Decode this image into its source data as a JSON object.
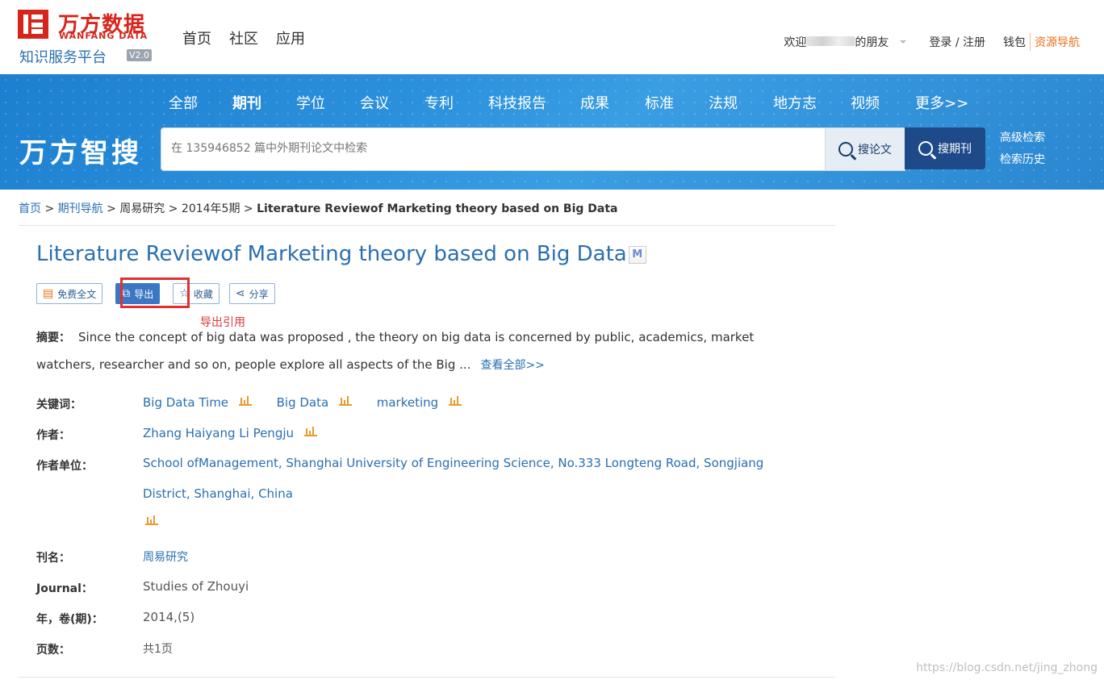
{
  "brand": {
    "logo_cn": "万方数据",
    "logo_en": "WANFANG DATA",
    "subtitle": "知识服务平台",
    "version": "V2.0",
    "search_brand": "万方智搜"
  },
  "top_nav": [
    "首页",
    "社区",
    "应用"
  ],
  "user": {
    "welcome_prefix": "欢迎",
    "welcome_suffix": "的朋友",
    "login": "登录 / 注册",
    "wallet": "钱包",
    "resources": "资源导航"
  },
  "categories": [
    "全部",
    "期刊",
    "学位",
    "会议",
    "专利",
    "科技报告",
    "成果",
    "标准",
    "法规",
    "地方志",
    "视频",
    "更多>>"
  ],
  "active_category": "期刊",
  "search": {
    "placeholder": "在 135946852 篇中外期刊论文中检索",
    "btn_paper": "搜论文",
    "btn_journal": "搜期刊",
    "advanced": "高级检索",
    "history": "检索历史"
  },
  "breadcrumb": {
    "home": "首页",
    "nav": "期刊导航",
    "journal": "周易研究",
    "issue": "2014年5期",
    "current": "Literature Reviewof Marketing theory based on Big Data",
    "sep": ">"
  },
  "article": {
    "title": "Literature Reviewof Marketing theory based on Big Data",
    "m_badge": "M",
    "actions": {
      "fulltext": "免费全文",
      "export": "导出",
      "favorite": "收藏",
      "share": "分享"
    },
    "annotation": "导出引用",
    "abstract_label": "摘要：",
    "abstract": "Since the concept of big data was proposed , the theory on big data is concerned by public, academics, market watchers, researcher and so on, people explore all aspects of the Big ...",
    "view_all": "查看全部>>",
    "keywords_label": "关键词：",
    "keywords": [
      "Big Data Time",
      "Big Data",
      "marketing"
    ],
    "authors_label": "作者：",
    "authors": "Zhang Haiyang Li Pengju",
    "affiliation_label": "作者单位：",
    "affiliation_line1": "School ofManagement, Shanghai University of Engineering Science, No.333 Longteng Road, Songjiang",
    "affiliation_line2": "District, Shanghai, China",
    "journal_cn_label": "刊名：",
    "journal_cn": "周易研究",
    "journal_en_label": "Journal：",
    "journal_en": "Studies of Zhouyi",
    "year_label": "年，卷(期)：",
    "year": "2014,(5)",
    "pages_label": "页数：",
    "pages": "共1页"
  },
  "watermark": "https://blog.csdn.net/jing_zhong"
}
